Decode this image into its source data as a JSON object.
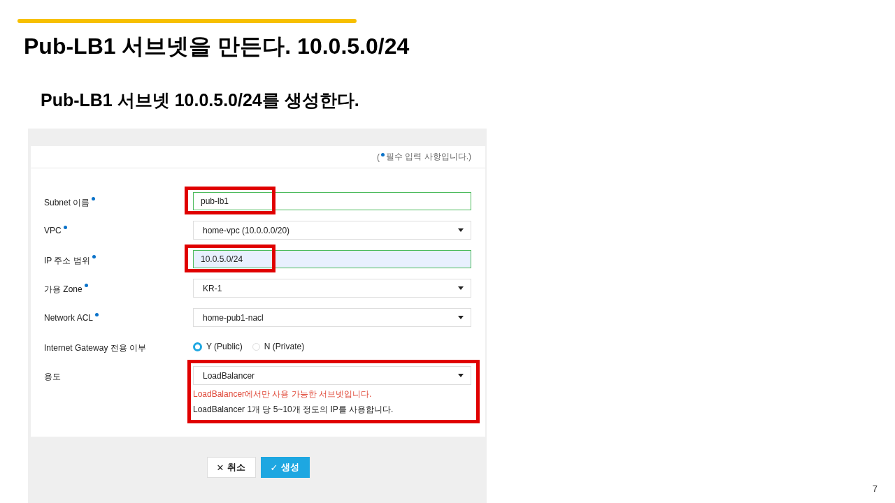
{
  "slide": {
    "title": "Pub-LB1 서브넷을 만든다. 10.0.5.0/24",
    "subtitle": "Pub-LB1 서브넷 10.0.5.0/24를 생성한다.",
    "page_number": "7"
  },
  "form": {
    "note_open": "(",
    "note": "필수 입력 사항입니다.)",
    "fields": [
      {
        "kind": "text",
        "label": "Subnet 이름",
        "required": true,
        "value": "pub-lb1",
        "highlighted": true
      },
      {
        "kind": "select",
        "label": "VPC",
        "required": true,
        "value": "home-vpc (10.0.0.0/20)",
        "highlighted": false
      },
      {
        "kind": "text",
        "label": "IP 주소 범위",
        "required": true,
        "value": "10.0.5.0/24",
        "highlighted": true
      },
      {
        "kind": "select",
        "label": "가용 Zone",
        "required": true,
        "value": "KR-1",
        "highlighted": false
      },
      {
        "kind": "select",
        "label": "Network ACL",
        "required": true,
        "value": "home-pub1-nacl",
        "highlighted": false
      },
      {
        "kind": "radio",
        "label": "Internet Gateway 전용 이부",
        "required": false,
        "options": [
          {
            "label": "Y (Public)",
            "selected": true
          },
          {
            "label": "N (Private)",
            "selected": false
          }
        ],
        "highlighted": false
      },
      {
        "kind": "select",
        "label": "용도",
        "required": false,
        "value": "LoadBalancer",
        "highlighted": true,
        "warning": "LoadBalancer에서만 사용 가능한 서브넷입니다.",
        "help": "LoadBalancer 1개 당 5~10개 정도의 IP를 사용합니다."
      }
    ],
    "buttons": [
      {
        "kind": "cancel",
        "icon": "✕",
        "label": "취소"
      },
      {
        "kind": "create",
        "icon": "✓",
        "label": "생성"
      }
    ]
  }
}
